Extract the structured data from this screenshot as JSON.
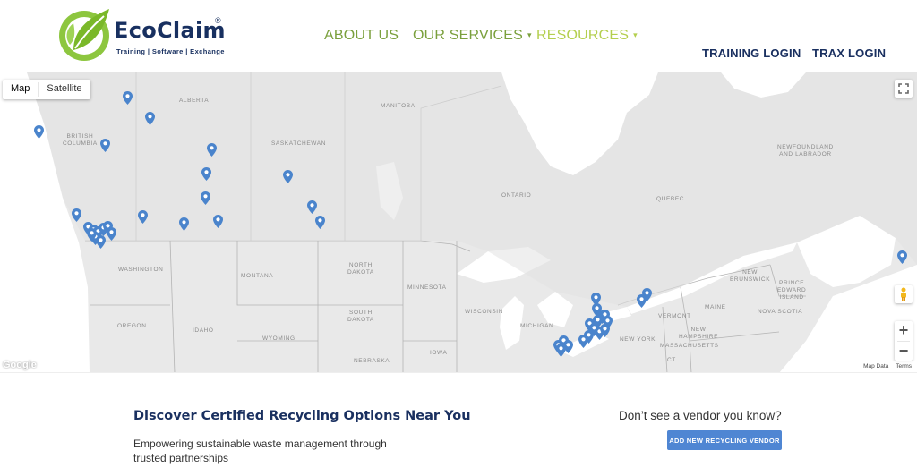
{
  "brand": {
    "name": "EcoClaim",
    "registered": "®",
    "tagline": "Training | Software | Exchange",
    "colors": {
      "navy": "#183060",
      "green": "#7aa03c",
      "lime": "#b4cf4e",
      "button": "#4f86d3"
    }
  },
  "nav": {
    "about": "ABOUT US",
    "services": "OUR SERVICES",
    "resources": "RESOURCES",
    "caret": "▾"
  },
  "logins": {
    "training": "TRAINING LOGIN",
    "trax": "TRAX LOGIN"
  },
  "map": {
    "type_options": [
      "Map",
      "Satellite"
    ],
    "selected_type": "Map",
    "controls": {
      "zoom_in": "+",
      "zoom_out": "−",
      "fullscreen_icon": "fullscreen-icon",
      "pegman_icon": "pegman-icon"
    },
    "attribution": {
      "google": "Google",
      "map_data": "Map Data",
      "terms": "Terms"
    },
    "region_labels": [
      "ALBERTA",
      "BRITISH\nCOLUMBIA",
      "MANITOBA",
      "SASKATCHEWAN",
      "NEWFOUNDLAND\nAND LABRADOR",
      "ONTARIO",
      "QUEBEC",
      "WASHINGTON",
      "MONTANA",
      "NORTH\nDAKOTA",
      "MINNESOTA",
      "SOUTH\nDAKOTA",
      "WISCONSIN",
      "MICHIGAN",
      "OREGON",
      "IDAHO",
      "WYOMING",
      "NEBRASKA",
      "IOWA",
      "NEW\nBRUNSWICK",
      "PRINCE\nEDWARD\nISLAND",
      "NOVA SCOTIA",
      "MAINE",
      "VERMONT",
      "NEW\nHAMPSHIRE",
      "MASSACHUSETTS",
      "NEW YORK",
      "CT"
    ]
  },
  "bottom": {
    "heading": "Discover Certified Recycling Options Near You",
    "description": "Empowering sustainable waste management through trusted partnerships",
    "prompt": "Don’t see a vendor you know?",
    "button": "ADD NEW RECYCLING VENDOR"
  }
}
